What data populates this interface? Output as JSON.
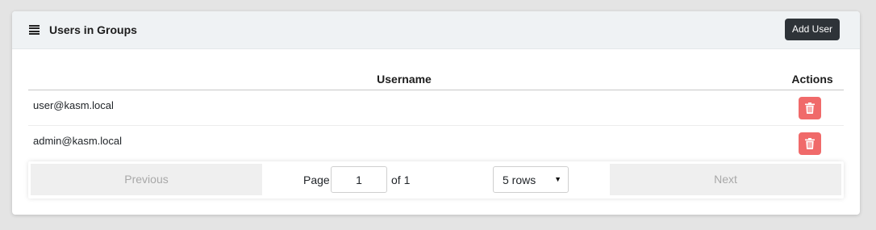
{
  "header": {
    "title": "Users in Groups",
    "add_button_label": "Add User",
    "icon": "list-icon"
  },
  "table": {
    "columns": [
      "Username",
      "Actions"
    ],
    "rows": [
      {
        "username": "user@kasm.local",
        "action_icon": "trash-icon"
      },
      {
        "username": "admin@kasm.local",
        "action_icon": "trash-icon"
      }
    ]
  },
  "pagination": {
    "previous_label": "Previous",
    "next_label": "Next",
    "page_label": "Page",
    "current_page": "1",
    "of_label": "of 1",
    "rows_selected": "5 rows"
  },
  "colors": {
    "header_bg": "#eff2f4",
    "add_button_bg": "#2e3338",
    "delete_button_bg": "#f06a6a",
    "disabled_button_bg": "#efefef"
  }
}
